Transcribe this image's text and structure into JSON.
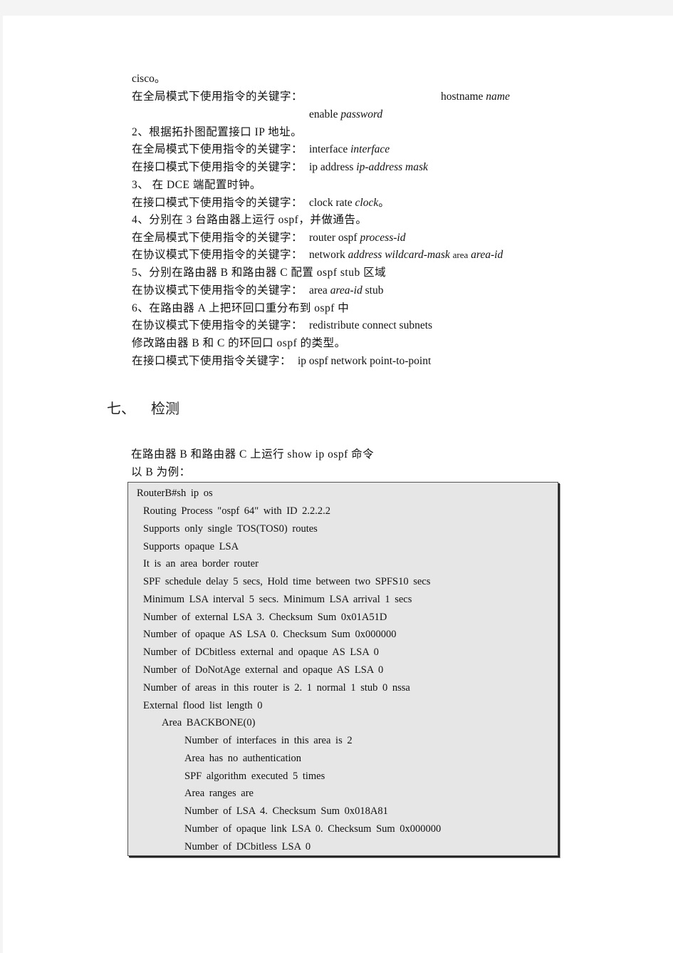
{
  "steps": {
    "l1": {
      "text": "cisco。"
    },
    "l2": {
      "prefix": "在全局模式下使用指令的关键字：",
      "cmd": "hostname",
      "arg": "name"
    },
    "l3": {
      "cmd": "enable",
      "arg": "password"
    },
    "l4": {
      "text": "2、根据拓扑图配置接口 IP 地址。"
    },
    "l5": {
      "prefix": "在全局模式下使用指令的关键字：",
      "cmd": "interface",
      "arg": "interface"
    },
    "l6": {
      "prefix": "在接口模式下使用指令的关键字：",
      "cmd": "ip address",
      "arg": "ip-address mask"
    },
    "l7": {
      "text": "3、  在 DCE 端配置时钟。"
    },
    "l8": {
      "prefix": "在接口模式下使用指令的关键字：",
      "cmd": "clock rate",
      "arg": "clock",
      "suffix": "。"
    },
    "l9": {
      "text": "4、分别在 3 台路由器上运行 ospf，并做通告。"
    },
    "l10": {
      "prefix": "在全局模式下使用指令的关键字：",
      "cmd": "router ospf",
      "arg": "process-id"
    },
    "l11": {
      "prefix": "在协议模式下使用指令的关键字：",
      "cmd": "network",
      "arg": "address wildcard-mask",
      "cmd2": "area",
      "arg2": "area-id"
    },
    "l12": {
      "text": "5、分别在路由器 B 和路由器 C 配置 ospf stub  区域"
    },
    "l13": {
      "prefix": "在协议模式下使用指令的关键字：",
      "cmd": "area",
      "arg": "area-id",
      "cmd2": "stub"
    },
    "l14": {
      "text": "6、在路由器 A 上把环回口重分布到 ospf 中"
    },
    "l15": {
      "prefix": "在协议模式下使用指令的关键字：",
      "cmd": "redistribute connect subnets"
    },
    "l16": {
      "text": "修改路由器 B 和 C 的环回口 ospf 的类型。"
    },
    "l17": {
      "prefix": "在接口模式下使用指令关键字：",
      "cmd": "ip ospf network point-to-point"
    }
  },
  "section": {
    "number": "七、",
    "title": "检测"
  },
  "intro": {
    "line1": "在路由器 B 和路由器 C 上运行 show ip ospf  命令",
    "line2": "以 B 为例："
  },
  "output": [
    "RouterB#sh ip os",
    "Routing Process \"ospf 64\" with ID 2.2.2.2",
    "Supports only single TOS(TOS0) routes",
    "Supports opaque LSA",
    "It is an area border router",
    "SPF schedule delay 5 secs, Hold time between two SPFS10 secs",
    "Minimum LSA interval 5 secs. Minimum LSA arrival 1 secs",
    "Number of external LSA 3. Checksum Sum 0x01A51D",
    "Number of opaque AS LSA 0. Checksum Sum 0x000000",
    "Number of DCbitless external and opaque AS LSA 0",
    "Number of DoNotAge external and opaque AS LSA 0",
    "Number of areas in this router is 2. 1 normal 1 stub 0 nssa",
    "External flood list length 0",
    "Area BACKBONE(0)",
    "Number of interfaces in this area is 2",
    "Area has no authentication",
    "SPF algorithm executed 5 times",
    "Area ranges are",
    "Number of LSA 4. Checksum Sum 0x018A81",
    "Number of opaque link LSA 0. Checksum Sum 0x000000",
    "Number of DCbitless LSA 0"
  ]
}
